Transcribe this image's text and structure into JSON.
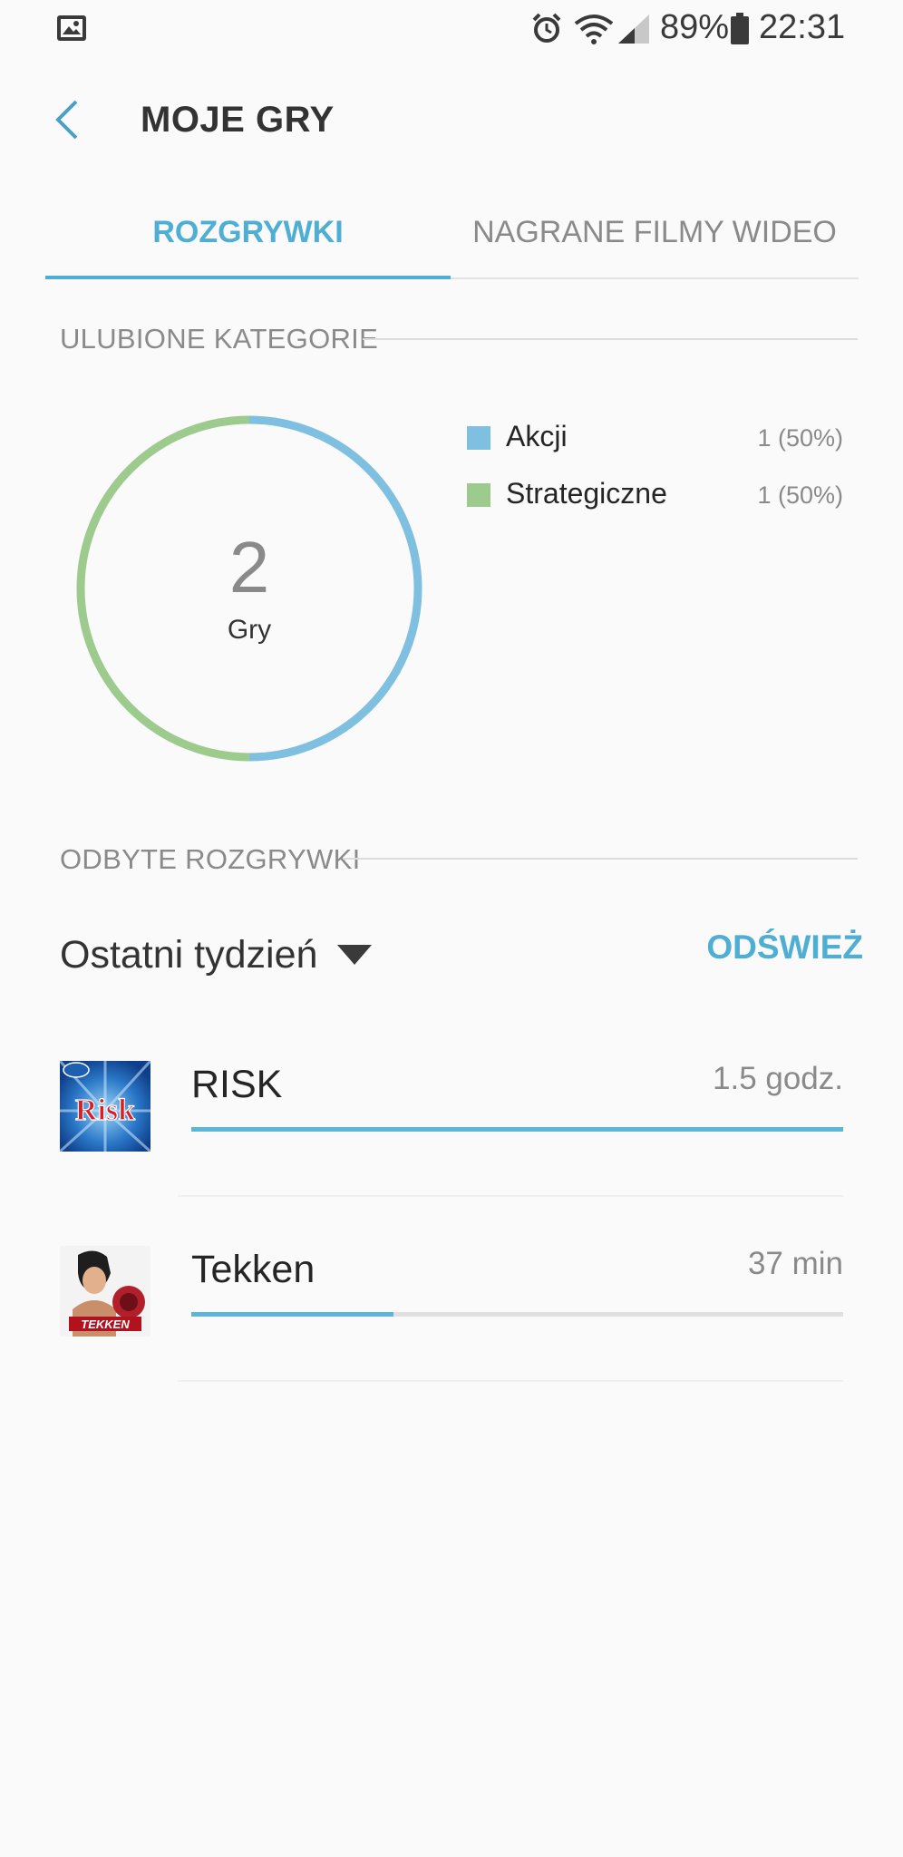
{
  "status_bar": {
    "battery": "89%",
    "time": "22:31"
  },
  "header": {
    "title": "MOJE GRY"
  },
  "tabs": [
    {
      "label": "ROZGRYWKI",
      "active": true
    },
    {
      "label": "NAGRANE FILMY WIDEO",
      "active": false
    }
  ],
  "favorite_categories": {
    "title": "ULUBIONE KATEGORIE",
    "total_count": "2",
    "total_label": "Gry",
    "legend": [
      {
        "label": "Akcji",
        "value": "1 (50%)",
        "color": "#7fbfe0"
      },
      {
        "label": "Strategiczne",
        "value": "1 (50%)",
        "color": "#9ccb8d"
      }
    ]
  },
  "chart_data": {
    "type": "pie",
    "categories": [
      "Akcji",
      "Strategiczne"
    ],
    "values": [
      1,
      1
    ],
    "colors": [
      "#7fbfe0",
      "#9ccb8d"
    ]
  },
  "played_games": {
    "title": "ODBYTE ROZGRYWKI",
    "filter": "Ostatni tydzień",
    "refresh_label": "ODŚWIEŻ",
    "items": [
      {
        "name": "RISK",
        "time": "1.5 godz.",
        "progress": 1.0,
        "icon_text": "Risk"
      },
      {
        "name": "Tekken",
        "time": "37 min",
        "progress": 0.31,
        "icon_text": "TEKKEN"
      }
    ]
  },
  "colors": {
    "accent": "#4eaed4",
    "bar_fill": "#5bb6da"
  }
}
